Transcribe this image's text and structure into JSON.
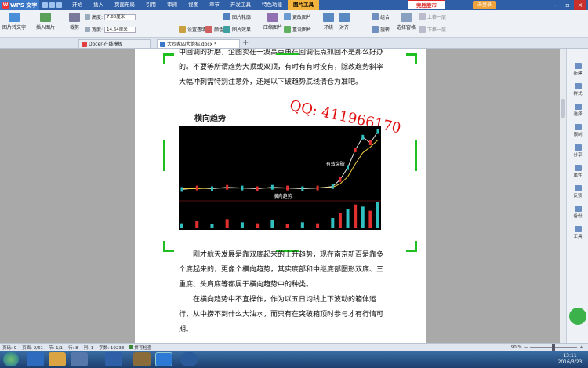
{
  "app": {
    "name": "WPS 文字"
  },
  "menu": {
    "tabs": [
      "开始",
      "插入",
      "页面布局",
      "引用",
      "审阅",
      "视图",
      "章节",
      "开发工具",
      "特色功能",
      "图片工具"
    ],
    "active_tab": "图片工具",
    "promo": "完胜股市",
    "login": "未登录"
  },
  "ribbon": {
    "pic_to_text": "图片转文字",
    "insert_pic": "插入图片",
    "crop": "裁剪",
    "height_label": "高度:",
    "height_value": "7.60厘米",
    "width_label": "宽度:",
    "width_value": "14.64厘米",
    "set_transparent": "设置透明色",
    "color": "颜色",
    "pic_outline": "图片轮廓",
    "pic_effect": "图片效果",
    "change_pic": "更改图片",
    "reset_pic": "重设图片",
    "compress_pic": "压缩图片",
    "wrap": "环绕",
    "align": "对齐",
    "rotate": "旋转",
    "group": "组合",
    "bring_forward": "上移一层",
    "send_backward": "下移一层",
    "select_pane": "选择窗格"
  },
  "doc_tabs": [
    {
      "title": "Docer-在线模板"
    },
    {
      "title": "大炒家四大绝招.docx *"
    }
  ],
  "document": {
    "para1": "中回调的折磨，企图卖在一波高点再在回调低点抓回不是那么好办的。不要等所谓趋势大顶或双顶，有时有有时没有，除改趋势斜率大幅冲刺需特别注意外，还是以下破趋势底线清仓为准吧。",
    "heading": "横向趋势",
    "watermark": "QQ: 411966170",
    "para2": "刚才航天发展是靠双底起来的上升趋势，现在南京新百是靠多个底起来的，更像个横向趋势，其实底部和中继底部图形双底、三重底、头肩底等都属于横向趋势中的种类。",
    "para3": "在横向趋势中不宜操作，作为以五日均线上下波动的箱体运行，从中捞不到什么大油水，而只有在突破箱顶时参与才有行情可期。"
  },
  "chart_data": {
    "type": "line",
    "annotations": [
      "有效突破",
      "横向趋势"
    ],
    "x": [
      0,
      10,
      20,
      30,
      40,
      50,
      60,
      70,
      80,
      90,
      100,
      105,
      110,
      115,
      120,
      125,
      130
    ],
    "series": [
      {
        "values": [
          14,
          16,
          15,
          17,
          16,
          15,
          17,
          16,
          15,
          16,
          18,
          28,
          45,
          70,
          88,
          80,
          96
        ]
      },
      {
        "values": [
          15,
          15,
          16,
          16,
          16,
          16,
          16,
          16,
          16,
          16,
          17,
          22,
          32,
          50,
          66,
          74,
          84
        ]
      }
    ],
    "volume": [
      4,
      6,
      3,
      8,
      5,
      4,
      7,
      3,
      5,
      4,
      9,
      14,
      18,
      22,
      20,
      16,
      24
    ]
  },
  "sidebar": {
    "items": [
      "新建",
      "样式",
      "选择",
      "限制",
      "分享",
      "属性",
      "反馈",
      "备份",
      "工具"
    ]
  },
  "status": {
    "page_no": "页码: 9",
    "page": "页面: 9/61",
    "section": "节: 1/1",
    "line": "行: 8",
    "col": "列: 1",
    "words": "字数: 19233",
    "spell": "拼写检查",
    "zoom": "90 %"
  },
  "clock": {
    "time": "13:11",
    "date": "2016/3/23"
  },
  "colors": {
    "accent": "#2f5fa6",
    "active_tab": "#f3b33d",
    "handle": "#1fbf1f",
    "watermark": "#e01010"
  }
}
